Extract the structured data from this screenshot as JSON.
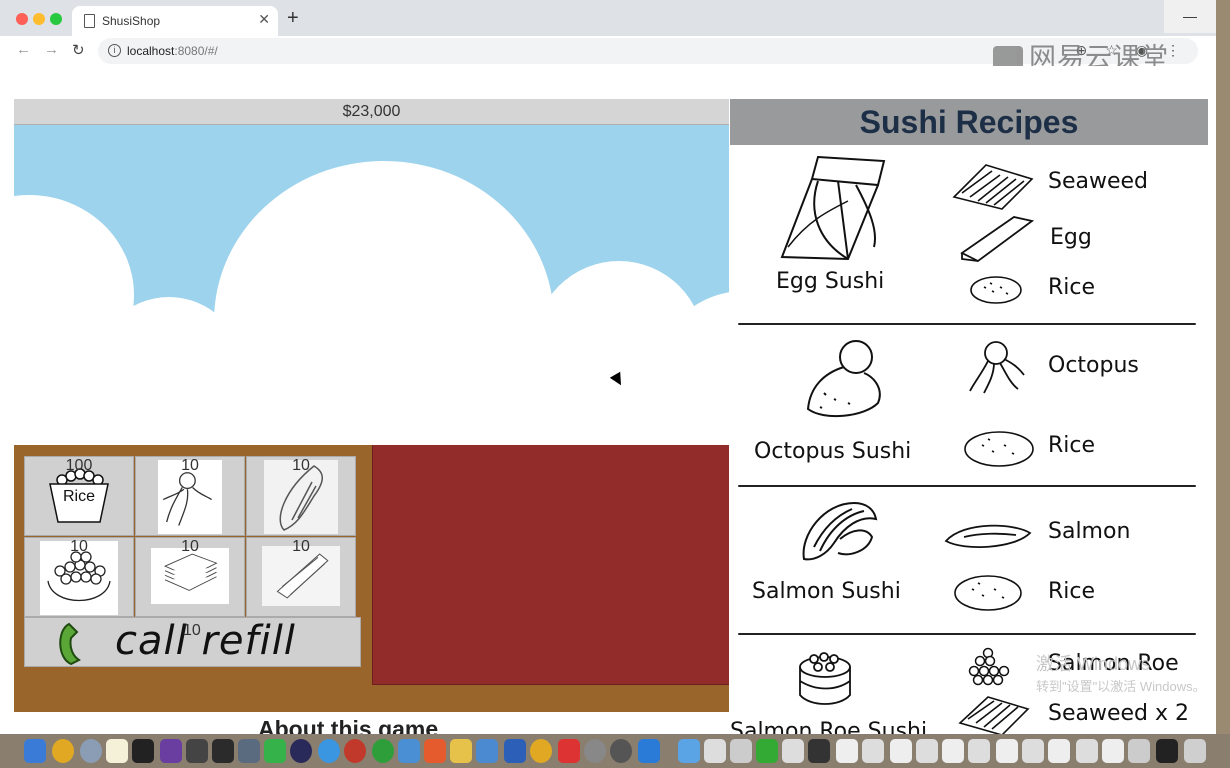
{
  "browser": {
    "tab_title": "ShusiShop",
    "url_host": "localhost",
    "url_rest": ":8080/#/",
    "minimize_glyph": "—"
  },
  "watermark": "网易云课堂",
  "game": {
    "money": "$23,000",
    "inventory": [
      {
        "count": "100",
        "label": "Rice",
        "icon": "rice-bowl-icon"
      },
      {
        "count": "10",
        "icon": "octopus-icon"
      },
      {
        "count": "10",
        "icon": "salmon-icon"
      },
      {
        "count": "10",
        "icon": "salmon-roe-icon"
      },
      {
        "count": "10",
        "icon": "seaweed-icon"
      },
      {
        "count": "10",
        "icon": "egg-icon"
      }
    ],
    "call_refill": {
      "label": "call refill",
      "count": "10",
      "icon": "phone-icon"
    },
    "about_heading": "About this game"
  },
  "recipes": {
    "title": "Sushi Recipes",
    "items": [
      {
        "name": "Egg Sushi",
        "ingredients": [
          "Seaweed",
          "Egg",
          "Rice"
        ]
      },
      {
        "name": "Octopus Sushi",
        "ingredients": [
          "Octopus",
          "Rice"
        ]
      },
      {
        "name": "Salmon Sushi",
        "ingredients": [
          "Salmon",
          "Rice"
        ]
      },
      {
        "name": "Salmon Roe Sushi",
        "ingredients": [
          "Salmon Roe",
          "Seaweed x 2"
        ]
      }
    ]
  },
  "windows_activation": {
    "line1": "激活 Windows",
    "line2": "转到\"设置\"以激活 Windows。"
  },
  "colors": {
    "sky": "#9dd3ec",
    "counter": "#922c2a",
    "wood": "#9a652a",
    "header_text": "#1d2f46"
  }
}
